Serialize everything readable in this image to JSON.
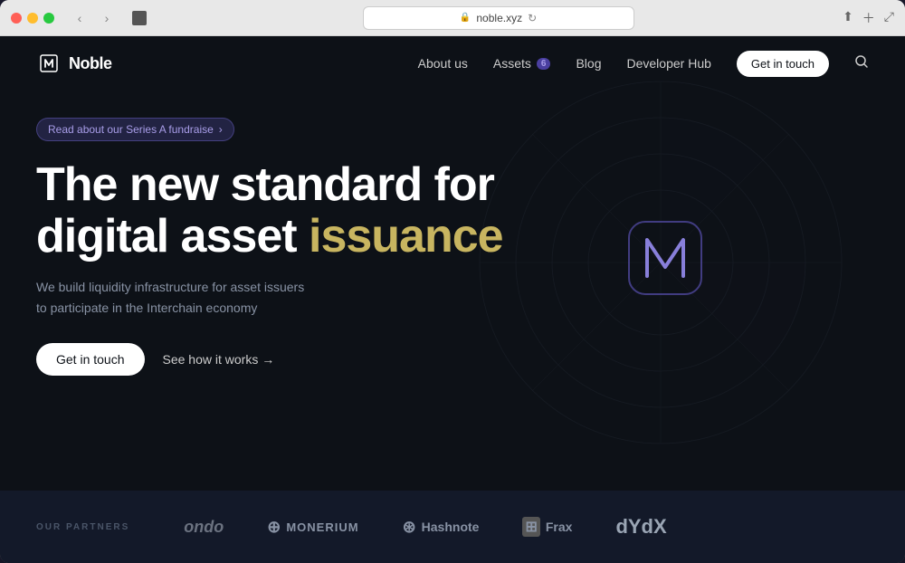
{
  "browser": {
    "url": "noble.xyz",
    "back_label": "‹",
    "forward_label": "›",
    "refresh_label": "↻",
    "share_label": "⬆",
    "new_tab_label": "+",
    "fullscreen_label": "⤢"
  },
  "navbar": {
    "logo_text": "Noble",
    "links": [
      {
        "label": "About us",
        "id": "about-us"
      },
      {
        "label": "Assets",
        "id": "assets",
        "badge": "6"
      },
      {
        "label": "Blog",
        "id": "blog"
      },
      {
        "label": "Developer Hub",
        "id": "developer-hub"
      }
    ],
    "cta_label": "Get in touch",
    "search_label": "🔍"
  },
  "hero": {
    "announcement": "Read about our Series A fundraise",
    "announcement_arrow": "›",
    "title_line1": "The new standard for",
    "title_line2": "digital asset issuance",
    "subtitle_line1": "We build liquidity infrastructure for asset issuers",
    "subtitle_line2": "to participate in the Interchain economy",
    "btn_primary": "Get in touch",
    "btn_secondary": "See how it works →"
  },
  "partners": {
    "label": "OUR PARTNERS",
    "logos": [
      {
        "name": "ondo",
        "display": "ondo",
        "symbol": ""
      },
      {
        "name": "monerium",
        "display": "MONERIUM",
        "symbol": "⊕"
      },
      {
        "name": "hashnote",
        "display": "Hashnote",
        "symbol": "⊛"
      },
      {
        "name": "frax",
        "display": "Frax",
        "symbol": "⊞"
      },
      {
        "name": "dydx",
        "display": "dYdX",
        "symbol": ""
      }
    ]
  },
  "colors": {
    "bg_dark": "#0d1117",
    "bg_navy": "#131929",
    "accent_purple": "#4a3fa0",
    "accent_yellow": "#c8b560",
    "text_white": "#ffffff",
    "text_muted": "#8892a4"
  }
}
